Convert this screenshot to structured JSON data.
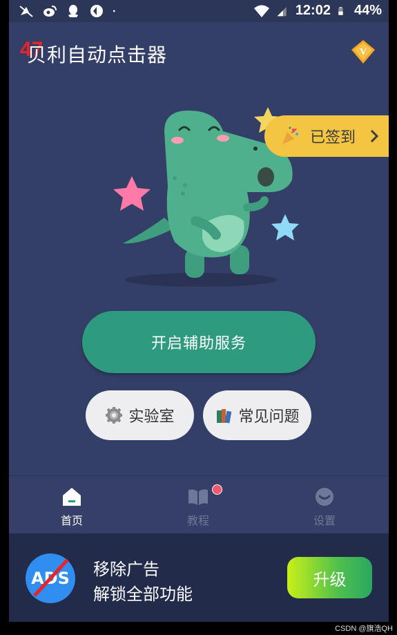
{
  "status_bar": {
    "time": "12:02",
    "battery": "44%",
    "left_icons": [
      "mute-icon",
      "weibo-icon",
      "qq-icon",
      "sync-icon",
      "dot-icon"
    ],
    "right_icons": [
      "wifi-icon",
      "signal-icon",
      "battery-icon"
    ]
  },
  "header": {
    "title": "贝利自动点击器",
    "badge": "47",
    "vip_icon": "vip-diamond-icon"
  },
  "checkin": {
    "label": "已签到"
  },
  "main": {
    "primary_button": "开启辅助服务",
    "lab_button": "实验室",
    "faq_button": "常见问题"
  },
  "bottom_nav": {
    "items": [
      {
        "label": "首页",
        "icon": "home-icon"
      },
      {
        "label": "教程",
        "icon": "book-icon"
      },
      {
        "label": "设置",
        "icon": "smile-icon"
      }
    ]
  },
  "ad_banner": {
    "line1": "移除广告",
    "line2": "解锁全部功能",
    "icon_text": "ADS",
    "upgrade_button": "升级"
  },
  "watermark": "CSDN @旗浩QH",
  "colors": {
    "background": "#333f66",
    "accent_green": "#2e9a7e",
    "checkin_yellow": "#f4c542",
    "ad_background": "#222b4a"
  }
}
